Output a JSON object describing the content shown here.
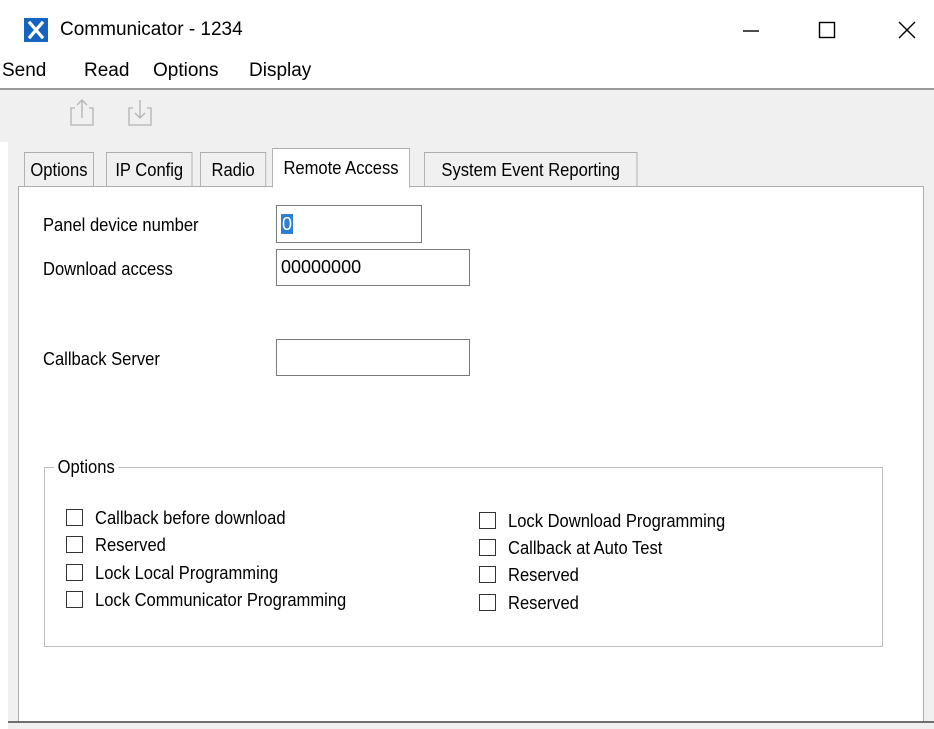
{
  "window": {
    "title": "Communicator - 1234",
    "controls": {
      "minimize": "—",
      "maximize": "☐",
      "close": "✕"
    }
  },
  "menu": [
    "Send",
    "Read",
    "Options",
    "Display"
  ],
  "toolbar": {
    "icons": [
      "upload-icon",
      "download-icon"
    ]
  },
  "tabs": [
    "Options",
    "IP Config",
    "Radio",
    "Remote Access",
    "System Event Reporting"
  ],
  "active_tab": "Remote Access",
  "remote_access": {
    "panel_device_number": {
      "label": "Panel device number",
      "value": "0"
    },
    "download_access": {
      "label": "Download access",
      "value": "00000000"
    },
    "callback_server": {
      "label": "Callback Server",
      "value": ""
    }
  },
  "options_group": {
    "title": "Options",
    "left": [
      {
        "label": "Callback before download",
        "checked": false
      },
      {
        "label": "Reserved",
        "checked": false
      },
      {
        "label": "Lock Local Programming",
        "checked": false
      },
      {
        "label": "Lock Communicator Programming",
        "checked": false
      }
    ],
    "right": [
      {
        "label": "Lock Download Programming",
        "checked": false
      },
      {
        "label": "Callback at Auto Test",
        "checked": false
      },
      {
        "label": "Reserved",
        "checked": false
      },
      {
        "label": "Reserved",
        "checked": false
      }
    ]
  },
  "colors": {
    "accent": "#2d7fd6",
    "app_icon": "#1565c0",
    "panel_bg": "#f0f0f0"
  }
}
